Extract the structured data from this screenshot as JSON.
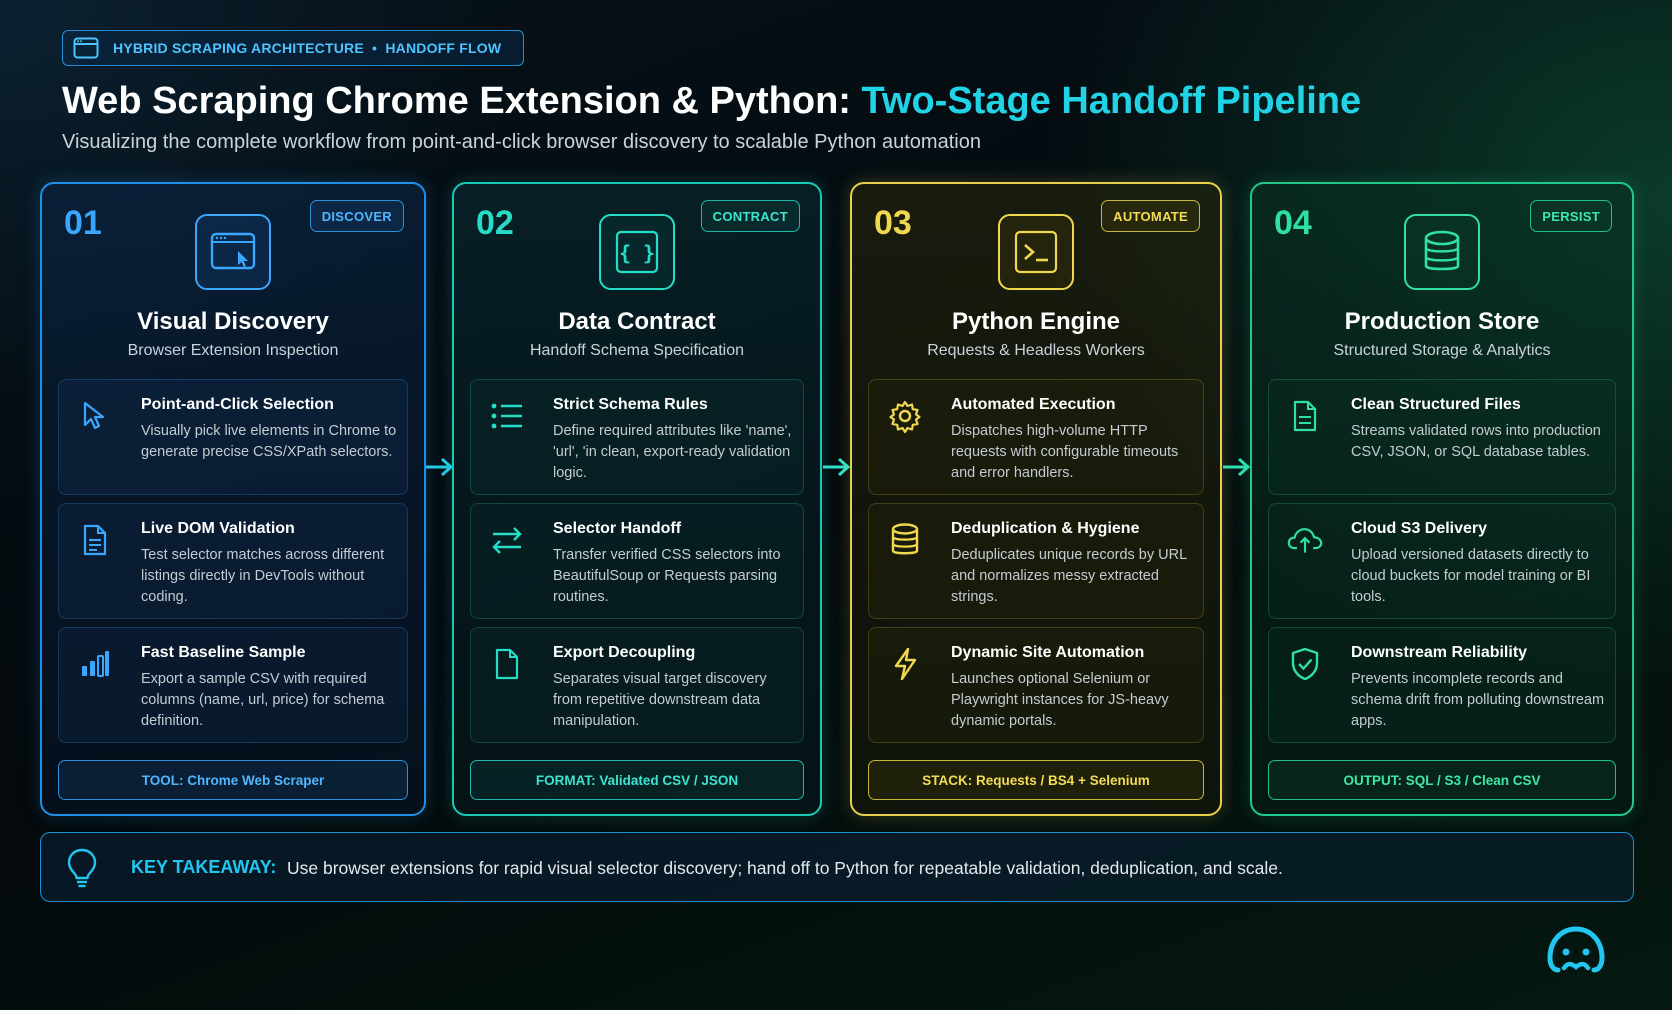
{
  "header": {
    "badge_label": "HYBRID SCRAPING ARCHITECTURE  •  HANDOFF FLOW",
    "badge_icon": "browser-window-icon",
    "title_main": "Web Scraping Chrome Extension & Python: ",
    "title_accent": "Two-Stage Handoff Pipeline",
    "subtitle": "Visualizing the complete workflow from point-and-click browser discovery to scalable Python automation"
  },
  "colors": {
    "stage1": "#1e90e8",
    "stage2": "#17c9b6",
    "stage3": "#e6cf4a",
    "stage4": "#1fc98a",
    "title_accent": "#22d3e6"
  },
  "stages": [
    {
      "number": "01",
      "tag": "DISCOVER",
      "icon": "browser-cursor-icon",
      "title": "Visual Discovery",
      "subtitle": "Browser Extension Inspection",
      "cards": [
        {
          "icon": "pointer-icon",
          "title": "Point-and-Click Selection",
          "body": "Visually pick live elements in Chrome to generate precise CSS/XPath selectors."
        },
        {
          "icon": "document-icon",
          "title": "Live DOM Validation",
          "body": "Test selector matches across different listings directly in DevTools without coding."
        },
        {
          "icon": "bar-chart-icon",
          "title": "Fast Baseline Sample",
          "body": "Export a sample CSV with required columns (name, url, price) for schema definition."
        }
      ],
      "footer": "TOOL: Chrome Web Scraper"
    },
    {
      "number": "02",
      "tag": "CONTRACT",
      "icon": "code-braces-icon",
      "title": "Data Contract",
      "subtitle": "Handoff Schema Specification",
      "cards": [
        {
          "icon": "list-icon",
          "title": "Strict Schema Rules",
          "body": "Define required attributes like 'name', 'url', 'in clean, export-ready validation logic."
        },
        {
          "icon": "swap-arrows-icon",
          "title": "Selector Handoff",
          "body": "Transfer verified CSS selectors into BeautifulSoup or Requests parsing routines."
        },
        {
          "icon": "file-icon",
          "title": "Export Decoupling",
          "body": "Separates visual target discovery from repetitive downstream data manipulation."
        }
      ],
      "footer": "FORMAT: Validated CSV / JSON"
    },
    {
      "number": "03",
      "tag": "AUTOMATE",
      "icon": "terminal-icon",
      "title": "Python Engine",
      "subtitle": "Requests & Headless Workers",
      "cards": [
        {
          "icon": "gear-icon",
          "title": "Automated Execution",
          "body": "Dispatches high-volume HTTP requests with configurable timeouts and error handlers."
        },
        {
          "icon": "database-icon",
          "title": "Deduplication & Hygiene",
          "body": "Deduplicates unique records by URL and normalizes messy extracted strings."
        },
        {
          "icon": "lightning-icon",
          "title": "Dynamic Site Automation",
          "body": "Launches optional Selenium or Playwright instances for JS-heavy dynamic portals."
        }
      ],
      "footer": "STACK: Requests / BS4 + Selenium"
    },
    {
      "number": "04",
      "tag": "PERSIST",
      "icon": "database-icon",
      "title": "Production Store",
      "subtitle": "Structured Storage & Analytics",
      "cards": [
        {
          "icon": "document-icon",
          "title": "Clean Structured Files",
          "body": "Streams validated rows into production CSV, JSON, or SQL database tables."
        },
        {
          "icon": "cloud-upload-icon",
          "title": "Cloud S3 Delivery",
          "body": "Upload versioned datasets directly to cloud buckets for model training or BI tools."
        },
        {
          "icon": "shield-check-icon",
          "title": "Downstream Reliability",
          "body": "Prevents incomplete records and schema drift from polluting downstream apps."
        }
      ],
      "footer": "OUTPUT: SQL / S3 / Clean CSV"
    }
  ],
  "takeaway": {
    "icon": "lightbulb-icon",
    "label": "KEY TAKEAWAY:",
    "text": "Use browser extensions for rapid visual selector discovery; hand off to Python for repeatable validation, deduplication, and scale."
  },
  "logo": {
    "icon": "brand-face-icon"
  }
}
